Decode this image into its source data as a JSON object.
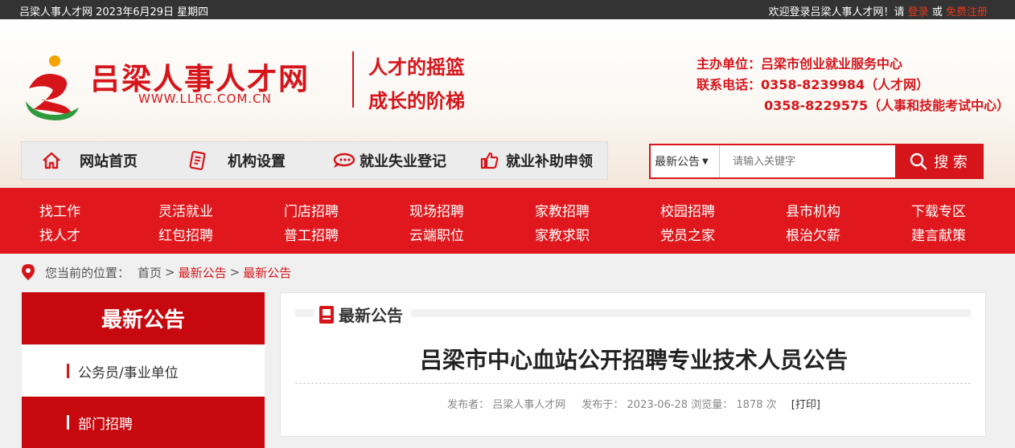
{
  "topbar": {
    "date": "吕梁人事人才网 2023年6月29日 星期四",
    "welcome": "欢迎登录吕梁人事人才网！请",
    "login": "登录",
    "or": "或",
    "register": "免费注册"
  },
  "header": {
    "site_name": "吕梁人事人才网",
    "site_url": "WWW.LLRC.COM.CN",
    "slogan1": "人才的摇篮",
    "slogan2": "成长的阶梯",
    "host": "主办单位：吕梁市创业就业服务中心",
    "phone1": "联系电话：0358-8239984（人才网）",
    "phone2": "0358-8229575（人事和技能考试中心）"
  },
  "nav": [
    {
      "label": "网站首页",
      "icon": "home-icon"
    },
    {
      "label": "机构设置",
      "icon": "document-icon"
    },
    {
      "label": "就业失业登记",
      "icon": "chat-icon"
    },
    {
      "label": "就业补助申领",
      "icon": "thumbs-up-icon"
    }
  ],
  "search": {
    "category": "最新公告",
    "placeholder": "请输入关键字",
    "button": "搜 索"
  },
  "menu": {
    "row1": [
      "找工作",
      "灵活就业",
      "门店招聘",
      "现场招聘",
      "家教招聘",
      "校园招聘",
      "县市机构",
      "下载专区"
    ],
    "row2": [
      "找人才",
      "红包招聘",
      "普工招聘",
      "云端职位",
      "家教求职",
      "党员之家",
      "根治欠薪",
      "建言献策"
    ]
  },
  "breadcrumb": {
    "prefix": "您当前的位置：",
    "home": "首页",
    "sep": ">",
    "level1": "最新公告",
    "level2": "最新公告"
  },
  "sidebar": {
    "title": "最新公告",
    "items": [
      {
        "label": "公务员/事业单位"
      },
      {
        "label": "部门招聘"
      }
    ]
  },
  "article": {
    "section": "最新公告",
    "title": "吕梁市中心血站公开招聘专业技术人员公告",
    "publisher_label": "发布者：",
    "publisher": "吕梁人事人才网",
    "date_label": "发布于：",
    "date": "2023-06-28",
    "views_label": "浏览量：",
    "views": "1878",
    "views_unit": "次",
    "print": "[打印]"
  },
  "colors": {
    "brand_red": "#d6151b",
    "dark_bar": "#333333",
    "side_red": "#c7090f"
  }
}
